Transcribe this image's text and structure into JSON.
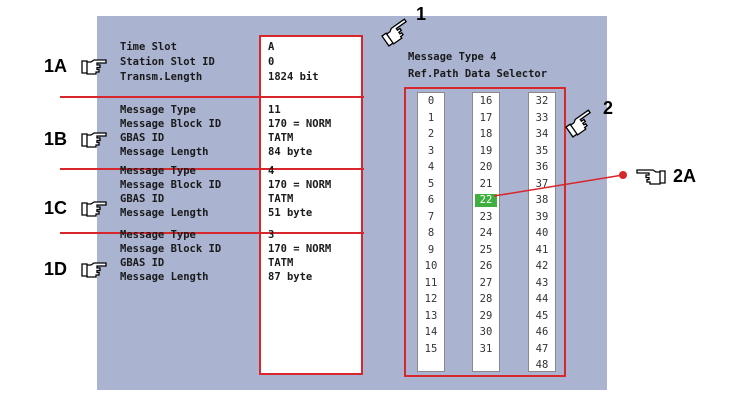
{
  "sections": [
    {
      "id": "1A",
      "rows": [
        {
          "label": "Time Slot",
          "value": "A"
        },
        {
          "label": "Station Slot ID",
          "value": "0"
        },
        {
          "label": "Transm.Length",
          "value": "1824 bit"
        }
      ]
    },
    {
      "id": "1B",
      "rows": [
        {
          "label": "Message Type",
          "value": "11"
        },
        {
          "label": "Message Block ID",
          "value": "170 = NORM"
        },
        {
          "label": "GBAS ID",
          "value": "TATM"
        },
        {
          "label": "Message Length",
          "value": "84 byte"
        }
      ]
    },
    {
      "id": "1C",
      "rows": [
        {
          "label": "Message Type",
          "value": "4"
        },
        {
          "label": "Message Block ID",
          "value": "170 = NORM"
        },
        {
          "label": "GBAS ID",
          "value": "TATM"
        },
        {
          "label": "Message Length",
          "value": "51 byte"
        }
      ]
    },
    {
      "id": "1D",
      "rows": [
        {
          "label": "Message Type",
          "value": "3"
        },
        {
          "label": "Message Block ID",
          "value": "170 = NORM"
        },
        {
          "label": "GBAS ID",
          "value": "TATM"
        },
        {
          "label": "Message Length",
          "value": "87 byte"
        }
      ]
    }
  ],
  "selector": {
    "title_line1": "Message Type 4",
    "title_line2": "Ref.Path Data Selector",
    "columns": [
      [
        "0",
        "1",
        "2",
        "3",
        "4",
        "5",
        "6",
        "7",
        "8",
        "9",
        "10",
        "11",
        "12",
        "13",
        "14",
        "15"
      ],
      [
        "16",
        "17",
        "18",
        "19",
        "20",
        "21",
        "22",
        "23",
        "24",
        "25",
        "26",
        "27",
        "28",
        "29",
        "30",
        "31"
      ],
      [
        "32",
        "33",
        "34",
        "35",
        "36",
        "37",
        "38",
        "39",
        "40",
        "41",
        "42",
        "43",
        "44",
        "45",
        "46",
        "47",
        "48"
      ]
    ],
    "selected": "22",
    "highlight_color": "#3fb040"
  },
  "callouts": {
    "c1": "1",
    "c1A": "1A",
    "c1B": "1B",
    "c1C": "1C",
    "c1D": "1D",
    "c2": "2",
    "c2A": "2A"
  },
  "colors": {
    "screen": "#aab4d0",
    "frame": "#d8262c"
  }
}
